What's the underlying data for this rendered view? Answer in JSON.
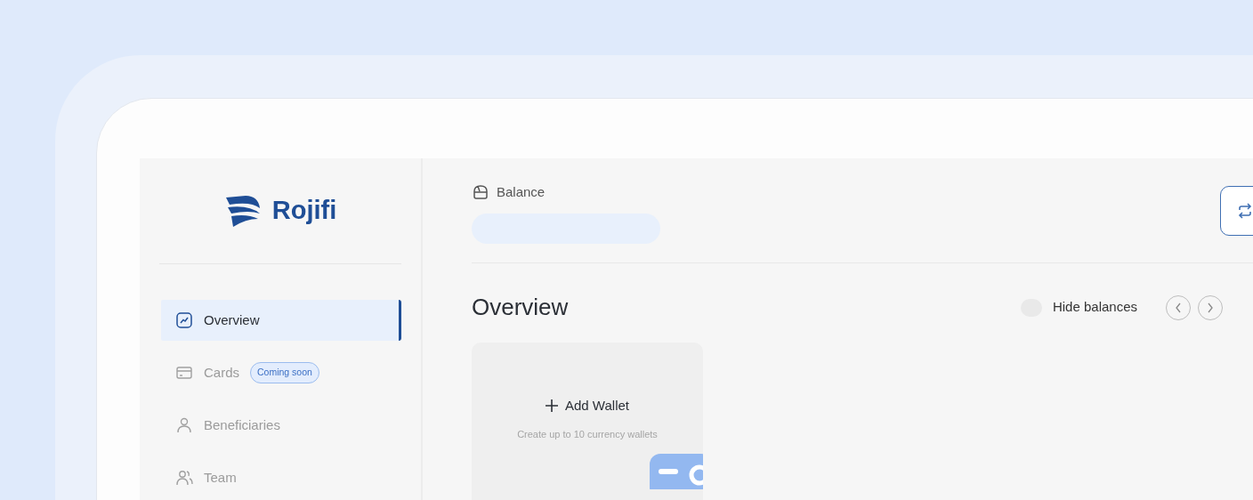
{
  "brand": {
    "name": "Rojifi"
  },
  "sidebar": {
    "items": [
      {
        "label": "Overview",
        "selected": true
      },
      {
        "label": "Cards",
        "selected": false,
        "badge": "Coming soon"
      },
      {
        "label": "Beneficiaries",
        "selected": false
      },
      {
        "label": "Team",
        "selected": false
      }
    ]
  },
  "balance": {
    "label": "Balance",
    "loading": true
  },
  "overview": {
    "title": "Overview",
    "hide_balances": {
      "label": "Hide balances",
      "on": false
    }
  },
  "add_wallet": {
    "label": "Add Wallet",
    "hint": "Create up to 10 currency wallets"
  }
}
